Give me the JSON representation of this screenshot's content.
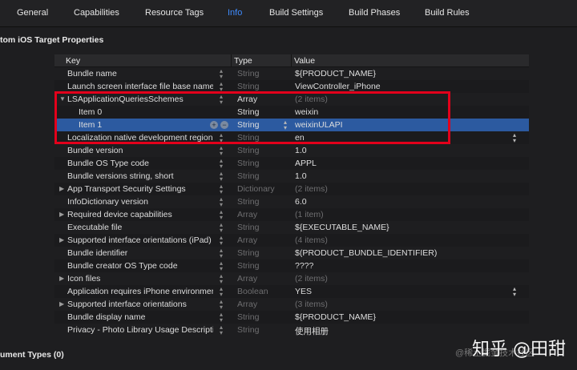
{
  "tabs": [
    {
      "label": "General",
      "active": false
    },
    {
      "label": "Capabilities",
      "active": false
    },
    {
      "label": "Resource Tags",
      "active": false
    },
    {
      "label": "Info",
      "active": true
    },
    {
      "label": "Build Settings",
      "active": false
    },
    {
      "label": "Build Phases",
      "active": false
    },
    {
      "label": "Build Rules",
      "active": false
    }
  ],
  "section_title": "tom iOS Target Properties",
  "section_footer": "ument Types (0)",
  "columns": {
    "key": "Key",
    "type": "Type",
    "value": "Value"
  },
  "rows": [
    {
      "key": "Bundle name",
      "type": "String",
      "value": "${PRODUCT_NAME}",
      "type_dim": true
    },
    {
      "key": "Launch screen interface file base name",
      "type": "String",
      "value": "ViewController_iPhone",
      "type_dim": true
    },
    {
      "key": "LSApplicationQueriesSchemes",
      "type": "Array",
      "value": "(2 items)",
      "expanded": true
    },
    {
      "key": "Item 0",
      "type": "String",
      "value": "weixin",
      "child": true
    },
    {
      "key": "Item 1",
      "type": "String",
      "value": "weixinULAPI",
      "child": true,
      "selected": true
    },
    {
      "key": "Localization native development region",
      "type": "String",
      "value": "en",
      "type_dim": true
    },
    {
      "key": "Bundle version",
      "type": "String",
      "value": "1.0",
      "type_dim": true
    },
    {
      "key": "Bundle OS Type code",
      "type": "String",
      "value": "APPL",
      "type_dim": true
    },
    {
      "key": "Bundle versions string, short",
      "type": "String",
      "value": "1.0",
      "type_dim": true
    },
    {
      "key": "App Transport Security Settings",
      "type": "Dictionary",
      "value": "(2 items)",
      "type_dim": true,
      "collapsed": true
    },
    {
      "key": "InfoDictionary version",
      "type": "String",
      "value": "6.0",
      "type_dim": true
    },
    {
      "key": "Required device capabilities",
      "type": "Array",
      "value": "(1 item)",
      "type_dim": true,
      "collapsed": true
    },
    {
      "key": "Executable file",
      "type": "String",
      "value": "${EXECUTABLE_NAME}",
      "type_dim": true
    },
    {
      "key": "Supported interface orientations (iPad)",
      "type": "Array",
      "value": "(4 items)",
      "type_dim": true,
      "collapsed": true
    },
    {
      "key": "Bundle identifier",
      "type": "String",
      "value": "$(PRODUCT_BUNDLE_IDENTIFIER)",
      "type_dim": true
    },
    {
      "key": "Bundle creator OS Type code",
      "type": "String",
      "value": "????",
      "type_dim": true
    },
    {
      "key": "Icon files",
      "type": "Array",
      "value": "(2 items)",
      "type_dim": true,
      "collapsed": true
    },
    {
      "key": "Application requires iPhone environment",
      "type": "Boolean",
      "value": "YES",
      "type_dim": true
    },
    {
      "key": "Supported interface orientations",
      "type": "Array",
      "value": "(3 items)",
      "type_dim": true,
      "collapsed": true
    },
    {
      "key": "Bundle display name",
      "type": "String",
      "value": "${PRODUCT_NAME}",
      "type_dim": true
    },
    {
      "key": "Privacy - Photo Library Usage Description",
      "type": "String",
      "value": "使用相册",
      "type_dim": true
    }
  ],
  "watermark": "知乎 @田甜",
  "watermark_sub": "@稀土掘金技术社区",
  "accent_color": "#3f8cff",
  "selection_color": "#2c5aa0",
  "highlight_color": "#e3001b"
}
